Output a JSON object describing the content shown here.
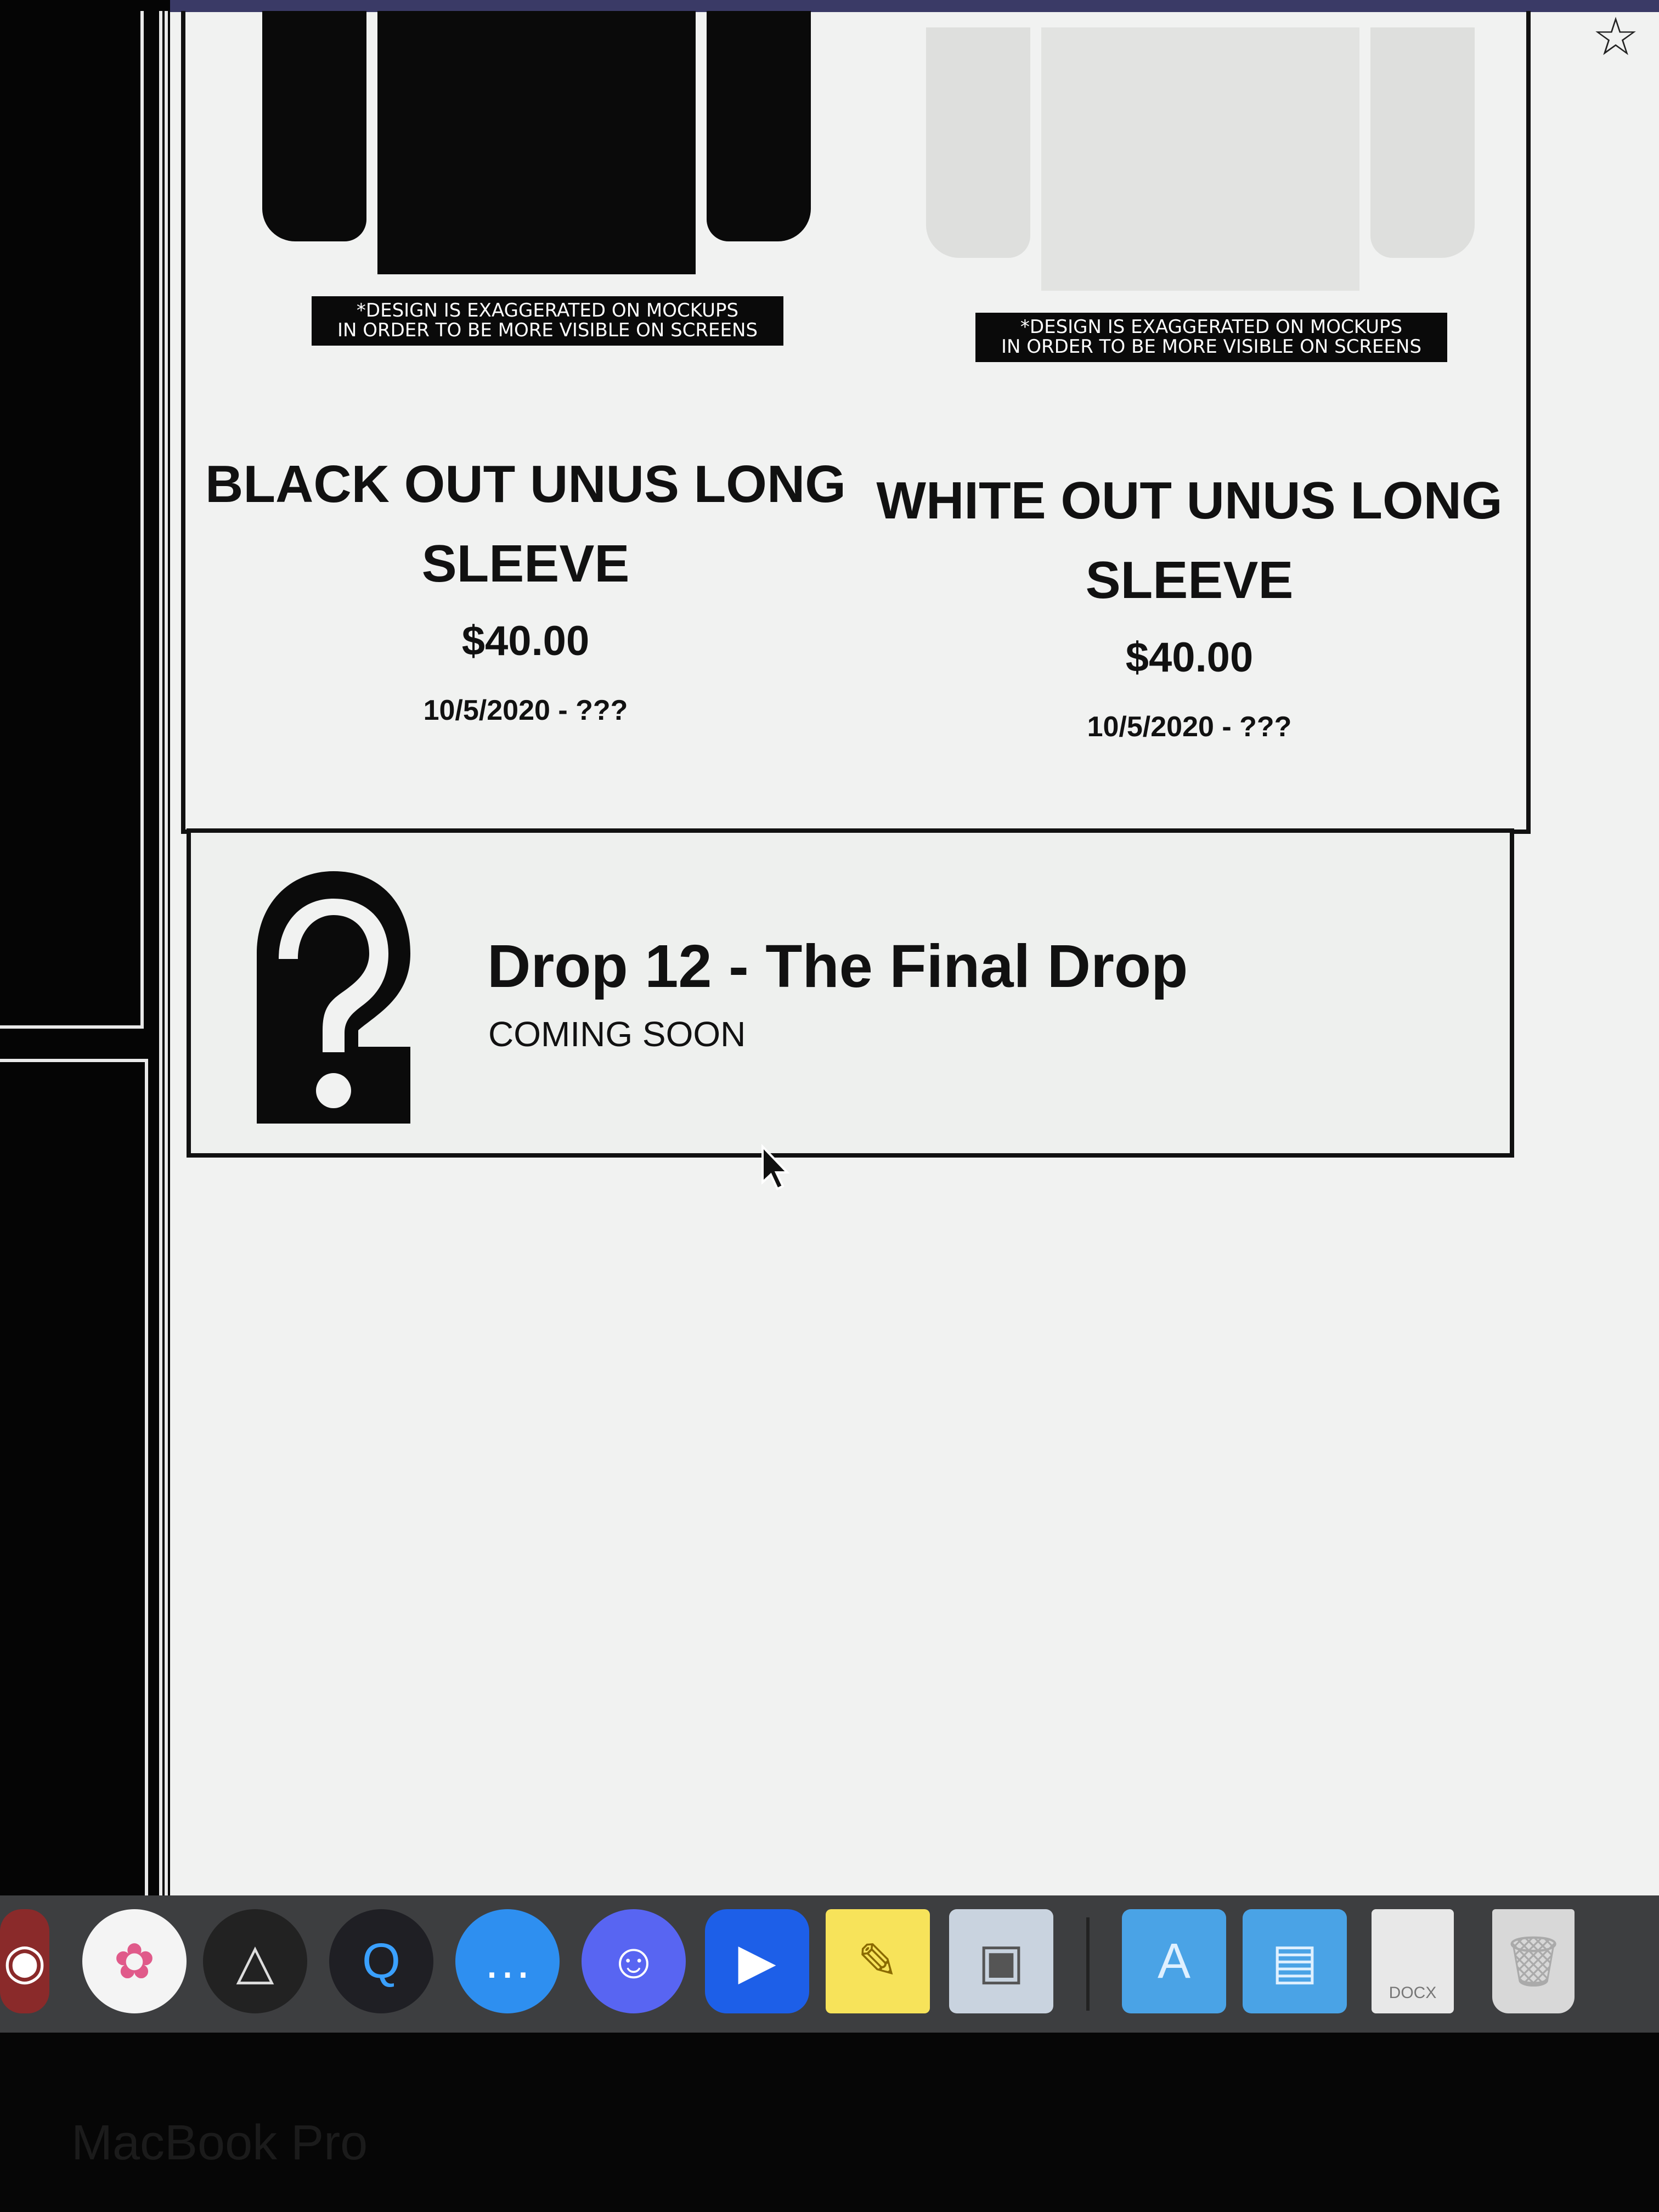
{
  "products": [
    {
      "disclaimer_line1": "*DESIGN IS EXAGGERATED ON MOCKUPS",
      "disclaimer_line2": "IN ORDER TO BE MORE VISIBLE ON SCREENS",
      "title_line1": "BLACK OUT UNUS LONG",
      "title_line2": "SLEEVE",
      "price": "$40.00",
      "date": "10/5/2020 - ???"
    },
    {
      "disclaimer_line1": "*DESIGN IS EXAGGERATED ON MOCKUPS",
      "disclaimer_line2": "IN ORDER TO BE MORE VISIBLE ON SCREENS",
      "title_line1": "WHITE OUT UNUS LONG",
      "title_line2": "SLEEVE",
      "price": "$40.00",
      "date": "10/5/2020 - ???"
    }
  ],
  "drop": {
    "title": "Drop 12 - The Final Drop",
    "subtitle": "COMING SOON",
    "icon": "question-mark-icon"
  },
  "dock": {
    "items": [
      "photo-booth",
      "photos",
      "prism",
      "quicktime",
      "messages",
      "discord",
      "zoom",
      "stickies",
      "preview",
      "applications-folder",
      "documents-folder",
      "docx-file",
      "trash"
    ],
    "docx_label": "DOCX"
  },
  "bezel": {
    "label": "MacBook Pro"
  }
}
